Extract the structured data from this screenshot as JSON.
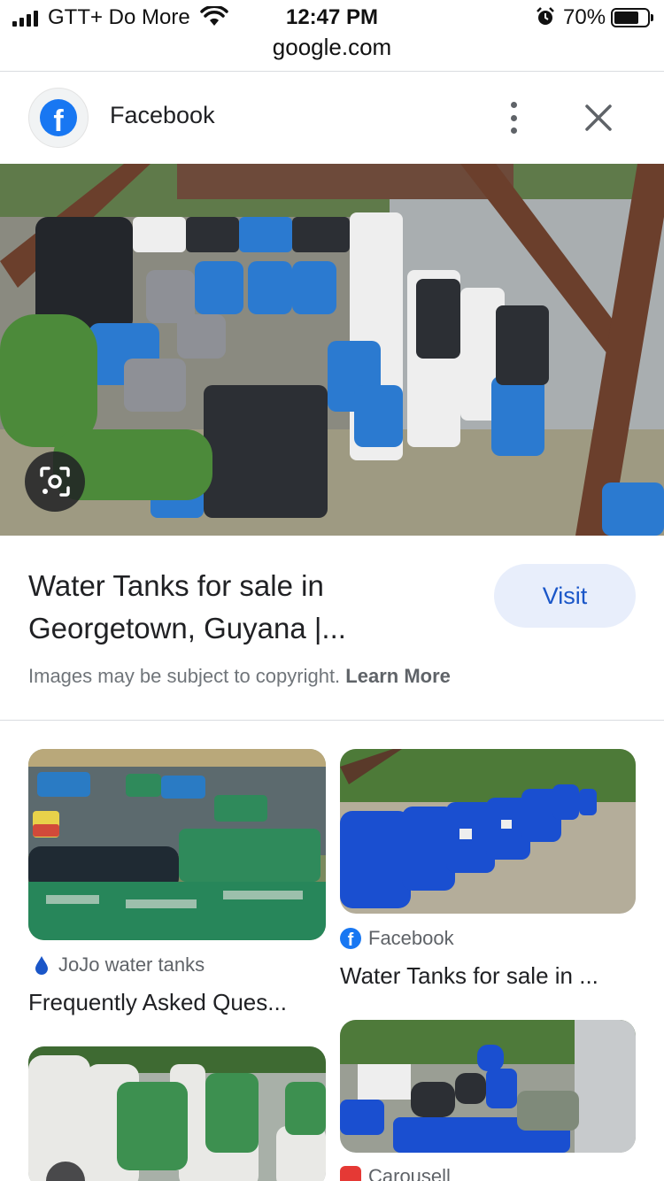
{
  "status_bar": {
    "carrier": "GTT+ Do More",
    "time": "12:47 PM",
    "battery": "70%",
    "battery_level": 0.7,
    "url": "google.com"
  },
  "source": {
    "icon": "facebook-icon",
    "name": "Facebook",
    "brand_color": "#1877f2"
  },
  "result": {
    "title_line1": "Water Tanks for sale in",
    "title_line2": "Georgetown, Guyana |...",
    "visit_label": "Visit",
    "copyright_text": "Images may be subject to copyright.",
    "learn_more": "Learn More"
  },
  "related": [
    {
      "source": "JoJo water tanks",
      "icon": "water-drop-icon",
      "title": "Frequently Asked Ques..."
    },
    {
      "source": "Facebook",
      "icon": "facebook-icon",
      "title": "Water Tanks for sale in ..."
    },
    {
      "source": "",
      "icon": "image-search-icon",
      "title": ""
    },
    {
      "source": "Carousell",
      "icon": "carousell-icon",
      "title": ""
    }
  ],
  "colors": {
    "accent": "#1a56c8",
    "visit_bg": "#e8eefb",
    "secondary_text": "#70757a"
  }
}
